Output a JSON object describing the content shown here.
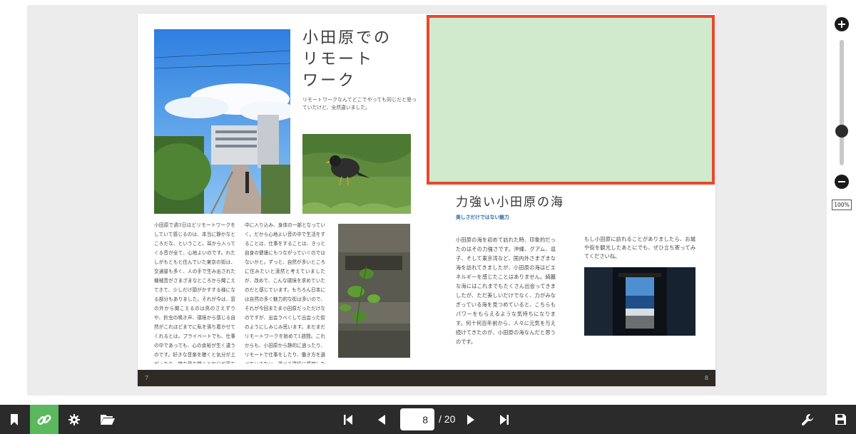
{
  "left_page": {
    "title_lines": [
      "小田原での",
      "リモート",
      "ワーク"
    ],
    "subtitle": "リモートワークなんてどこでやっても同じだと思っていたけど、全然違いました。",
    "col1": "小田原で週3日ほどリモートワークをしていて感じるのは、本当に静かなところだな、ということ。耳から入ってくる音が全て、心地よいのです。わたしがもともと住んでいた東京の街は、交通量も多く、人の手で生み出された機械音がさまざまなところから聞こえてきて、少しだけ頭がかすする様になる部分もありました。それが今は、窓の外から聞こえるのは鳥のさえずりや、鈴虫の鳴き声、環境から感じる自然がこれほどまでに私を落ち着かせてくれるとは。プライベートでも、仕事の中であっても、心の余裕が生く違うのです。好きな音楽を聴くと気分が上がったり、嫌な音を聞くと気分が落ちたりするように、耳から入ってくる言えない何かは、心にダイレクトに響きます。生活の中で聞こえる音は、知らず知らずのうちに自分の",
    "col2": "中に入り込み、身体の一部となっていく。だから心地よい音の中で生活をすることは、仕事をすることは、きっと自身の健康にもつながっていくのではないかと。ずっと、自然が多いところに住みたいと漠然と考えていましたが、改めて、こんな環境を求めていたのだと感じています。もちろん日本には自然の多く魅力的な街は多いので、それが今回またま小田原だっただけなのですが、出会うべくして出会った街のようにしみじみ思います。まだまだリモートワークを始めて1週間。これからも、小田原から静的に過ったり、リモートで仕事をしたり、働き方を選べていきたい。選べる環境に感謝したい。仕事とプライベートを分けるのが苦手なタイプでもあるので、どちらも楽しいと、より良くしていきます。",
    "page_number": "7"
  },
  "right_page": {
    "title": "力強い小田原の海",
    "subtitle": "美しさだけではない魅力",
    "col1": "小田原の海を初めて訪れた時、印象的だったのはその力強さです。沖縄、グアム、逗子、そして東京湾など、国内外さまざまな海を訪れてきましたが、小田原の海はビエネルギーを感じたことはありません。綺麗な海にはこれまでもたくさん出会ってきましたが、ただ美しいだけでなく、力がみなぎっている海を見つめていると、こちらもパワーをもらえるような気持ちになります。何十何百年前から、人々に元気を与え続けてきたのが、小田原の海なんだと思うのです。",
    "col2": "もし小田原に訪れることがありましたら、お城や街を観光したあとにでも、ぜひ立ち寄ってみてくださいね。",
    "page_number": "8"
  },
  "zoom": {
    "level_label": "100%",
    "level": 0.25
  },
  "toolbar": {
    "current_page": "8",
    "total_pages": "/ 20"
  },
  "colors": {
    "placeholder_fill": "#d1e9cd",
    "placeholder_border": "#e8472f",
    "toolbar_bg": "#2b2b2b",
    "link_active": "#5bb85c",
    "footer_bar": "#302a26"
  }
}
